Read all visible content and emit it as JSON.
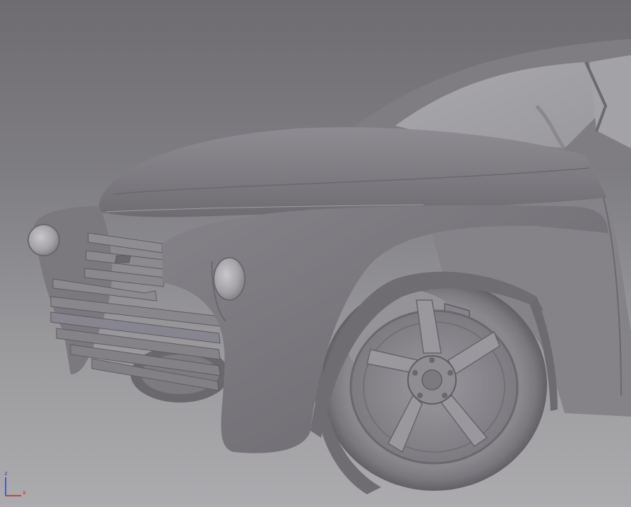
{
  "viewport": {
    "background_top": "#6e6c70",
    "background_bottom": "#acabae",
    "model_color": "#8d8b90",
    "model_shadow": "#5f5d62",
    "model_highlight": "#b9b7bc"
  },
  "gizmo": {
    "z_label": "z",
    "x_label": "x",
    "z_color": "#2b40c8",
    "x_color": "#d02020"
  }
}
